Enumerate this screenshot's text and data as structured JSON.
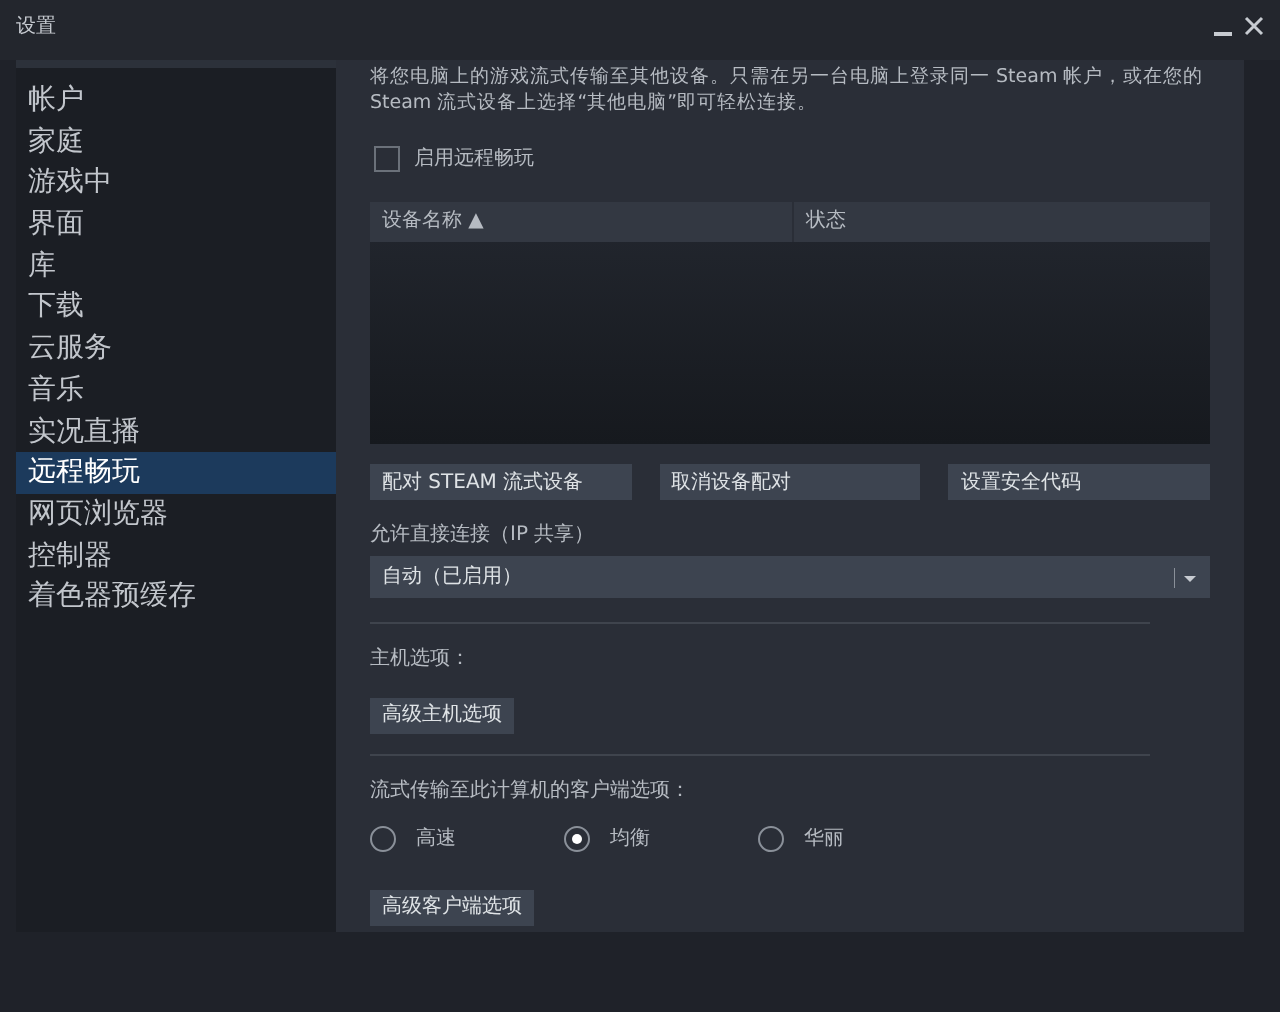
{
  "window": {
    "title": "设置"
  },
  "sidebar": {
    "items": [
      {
        "label": "帐户",
        "selected": false
      },
      {
        "label": "家庭",
        "selected": false
      },
      {
        "label": "游戏中",
        "selected": false
      },
      {
        "label": "界面",
        "selected": false
      },
      {
        "label": "库",
        "selected": false
      },
      {
        "label": "下载",
        "selected": false
      },
      {
        "label": "云服务",
        "selected": false
      },
      {
        "label": "音乐",
        "selected": false
      },
      {
        "label": "实况直播",
        "selected": false
      },
      {
        "label": "远程畅玩",
        "selected": true
      },
      {
        "label": "网页浏览器",
        "selected": false
      },
      {
        "label": "控制器",
        "selected": false
      },
      {
        "label": "着色器预缓存",
        "selected": false
      }
    ]
  },
  "content": {
    "description": "将您电脑上的游戏流式传输至其他设备。只需在另一台电脑上登录同一 Steam 帐户，或在您的 Steam 流式设备上选择“其他电脑”即可轻松连接。",
    "enable_checkbox": {
      "label": "启用远程畅玩",
      "checked": false
    },
    "table": {
      "columns": [
        "设备名称 ▲",
        "状态"
      ]
    },
    "buttons": [
      "配对 STEAM 流式设备",
      "取消设备配对",
      "设置安全代码"
    ],
    "direct_connection": {
      "label": "允许直接连接（IP 共享）",
      "value": "自动（已启用）"
    },
    "host_options": {
      "label": "主机选项：",
      "button": "高级主机选项"
    },
    "client_options": {
      "label": "流式传输至此计算机的客户端选项：",
      "radios": [
        {
          "label": "高速",
          "selected": false
        },
        {
          "label": "均衡",
          "selected": true
        },
        {
          "label": "华丽",
          "selected": false
        }
      ],
      "button": "高级客户端选项"
    }
  }
}
